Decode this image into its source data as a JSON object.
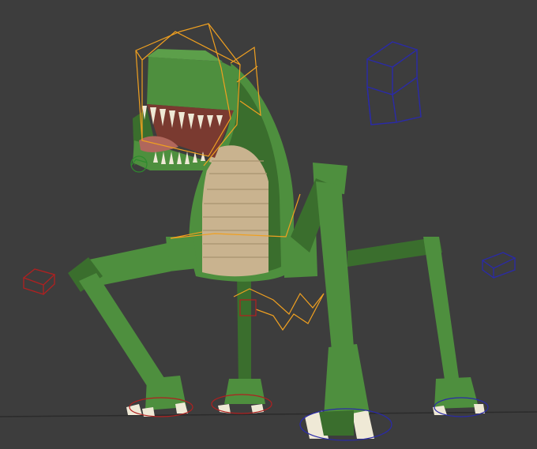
{
  "viewport": {
    "view_kind": "3d-viewport",
    "background_color": "#3d3d3d",
    "selection_color": "#f0a020",
    "empty_blue_color": "#2a2aa8",
    "empty_red_color": "#b02020",
    "ground_line_color": "#2b2b2b"
  },
  "scene": {
    "model": {
      "body_color": "#4e8f3e",
      "body_dark_color": "#3a6e2d",
      "belly_color": "#c9b38f",
      "teeth_color": "#efe9d6",
      "mouth_color": "#7a3a30"
    },
    "objects": [
      {
        "name": "creature-mesh",
        "icon": "mesh-icon"
      },
      {
        "name": "head-bone",
        "icon": "bone-icon"
      },
      {
        "name": "spine-bone",
        "icon": "bone-icon"
      },
      {
        "name": "leg-controls",
        "icon": "circle-control-icon"
      },
      {
        "name": "blue-cube-empty-large",
        "icon": "cube-empty-icon"
      },
      {
        "name": "blue-cube-empty-small",
        "icon": "cube-empty-icon"
      },
      {
        "name": "red-cube-empty",
        "icon": "cube-empty-icon"
      }
    ]
  }
}
